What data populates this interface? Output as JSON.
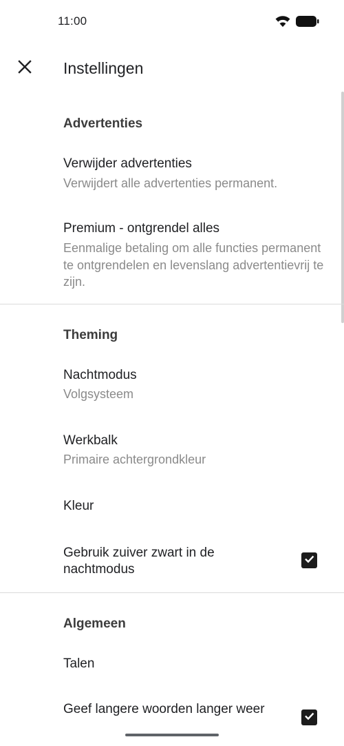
{
  "status_bar": {
    "time": "11:00",
    "icons": [
      "wifi-icon",
      "battery-icon"
    ]
  },
  "app_bar": {
    "title": "Instellingen",
    "close_icon": "close-icon"
  },
  "sections": {
    "ads": {
      "header": "Advertenties",
      "remove_ads": {
        "title": "Verwijder advertenties",
        "summary": "Verwijdert alle advertenties permanent."
      },
      "premium": {
        "title": "Premium - ontgrendel alles",
        "summary": "Eenmalige betaling om alle functies permanent te ontgrendelen en levenslang advertentievrij te zijn."
      }
    },
    "theming": {
      "header": "Theming",
      "night_mode": {
        "title": "Nachtmodus",
        "summary": "Volgsysteem"
      },
      "toolbar": {
        "title": "Werkbalk",
        "summary": "Primaire achtergrondkleur"
      },
      "color": {
        "title": "Kleur"
      },
      "pure_black": {
        "title": "Gebruik zuiver zwart in de nachtmodus",
        "checked": true
      }
    },
    "general": {
      "header": "Algemeen",
      "languages": {
        "title": "Talen"
      },
      "longer_words": {
        "title": "Geef langere woorden langer weer",
        "checked": true
      }
    }
  }
}
